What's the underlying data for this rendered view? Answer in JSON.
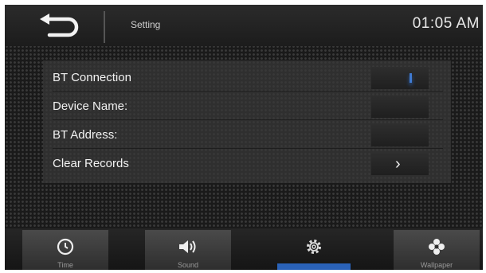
{
  "header": {
    "title": "Setting",
    "clock": "01:05 AM",
    "back_icon": "back-arrow-icon"
  },
  "rows": [
    {
      "label": "BT Connection",
      "control": "toggle",
      "icon": "toggle-indicator-icon"
    },
    {
      "label": "Device Name:",
      "control": "none"
    },
    {
      "label": "BT Address:",
      "control": "none"
    },
    {
      "label": "Clear Records",
      "control": "chevron",
      "icon": "chevron-right-icon",
      "chevron": "›"
    }
  ],
  "tabs": [
    {
      "label": "Time",
      "icon": "clock-icon",
      "active": false
    },
    {
      "label": "Sound",
      "icon": "speaker-icon",
      "active": false
    },
    {
      "label": "",
      "icon": "gear-icon",
      "active": true
    },
    {
      "label": "Wallpaper",
      "icon": "wallpaper-icon",
      "active": false
    }
  ],
  "colors": {
    "accent": "#2a62b8"
  }
}
